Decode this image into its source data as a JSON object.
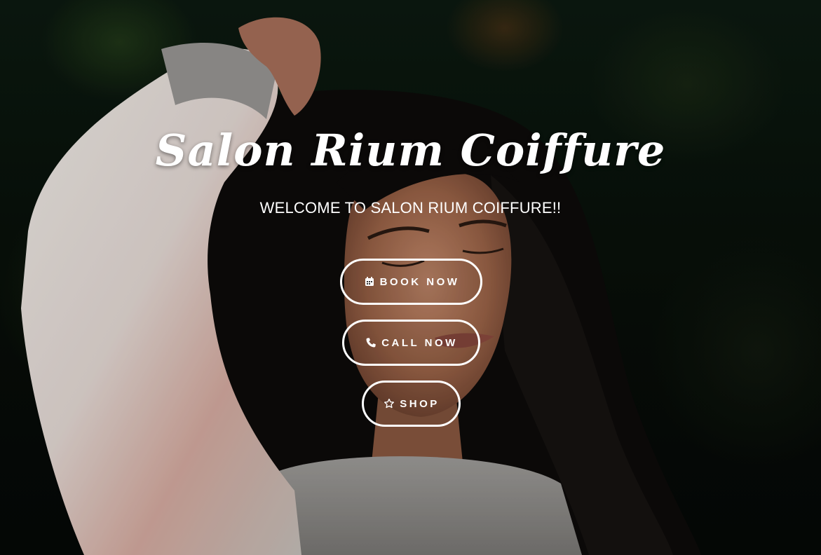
{
  "hero": {
    "title": "Salon Rium Coiffure",
    "subtitle": "WELCOME TO SALON RIUM COIFFURE!!"
  },
  "buttons": {
    "book": {
      "label": "BOOK NOW",
      "icon": "calendar-icon"
    },
    "call": {
      "label": "CALL NOW",
      "icon": "phone-icon"
    },
    "shop": {
      "label": "SHOP",
      "icon": "star-icon"
    }
  },
  "colors": {
    "text": "#ffffff",
    "button_border": "#ffffff"
  }
}
